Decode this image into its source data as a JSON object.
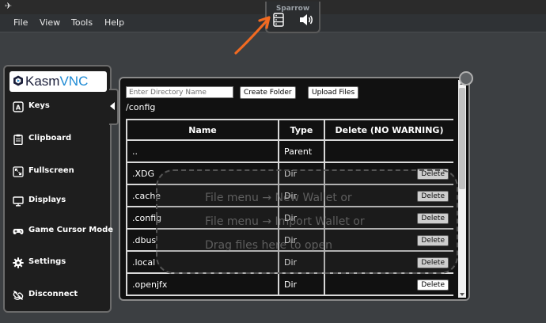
{
  "desktop": {
    "menu": [
      "File",
      "View",
      "Tools",
      "Help"
    ]
  },
  "sparrow_panel": {
    "title": "Sparrow"
  },
  "kasm": {
    "logo_kasm": "Kasm",
    "logo_vnc": "VNC",
    "items": [
      {
        "label": "Keys",
        "icon": "keyboard-a-icon"
      },
      {
        "label": "Clipboard",
        "icon": "clipboard-icon"
      },
      {
        "label": "Fullscreen",
        "icon": "fullscreen-icon"
      },
      {
        "label": "Displays",
        "icon": "monitor-icon"
      },
      {
        "label": "Game Cursor Mode",
        "icon": "gamepad-icon"
      },
      {
        "label": "Settings",
        "icon": "gear-icon"
      },
      {
        "label": "Disconnect",
        "icon": "disconnect-icon"
      }
    ]
  },
  "file_panel": {
    "dir_placeholder": "Enter Directory Name",
    "create_folder": "Create Folder",
    "upload_files": "Upload Files",
    "current_path": "/config",
    "columns": [
      "Name",
      "Type",
      "Delete (NO WARNING)"
    ],
    "delete_label": "Delete",
    "rows": [
      {
        "name": "..",
        "type": "Parent",
        "deletable": false
      },
      {
        "name": ".XDG",
        "type": "Dir",
        "deletable": true
      },
      {
        "name": ".cache",
        "type": "Dir",
        "deletable": true
      },
      {
        "name": ".config",
        "type": "Dir",
        "deletable": true
      },
      {
        "name": ".dbus",
        "type": "Dir",
        "deletable": true
      },
      {
        "name": ".local",
        "type": "Dir",
        "deletable": true
      },
      {
        "name": ".openjfx",
        "type": "Dir",
        "deletable": true
      }
    ]
  },
  "dropzone": {
    "lines": [
      "File menu → New Wallet or",
      "File menu → Import Wallet or",
      "Drag files here to open"
    ]
  },
  "colors": {
    "arrow": "#f26a21",
    "kasm_blue": "#1d8ad4",
    "panel_bg": "#111111"
  }
}
